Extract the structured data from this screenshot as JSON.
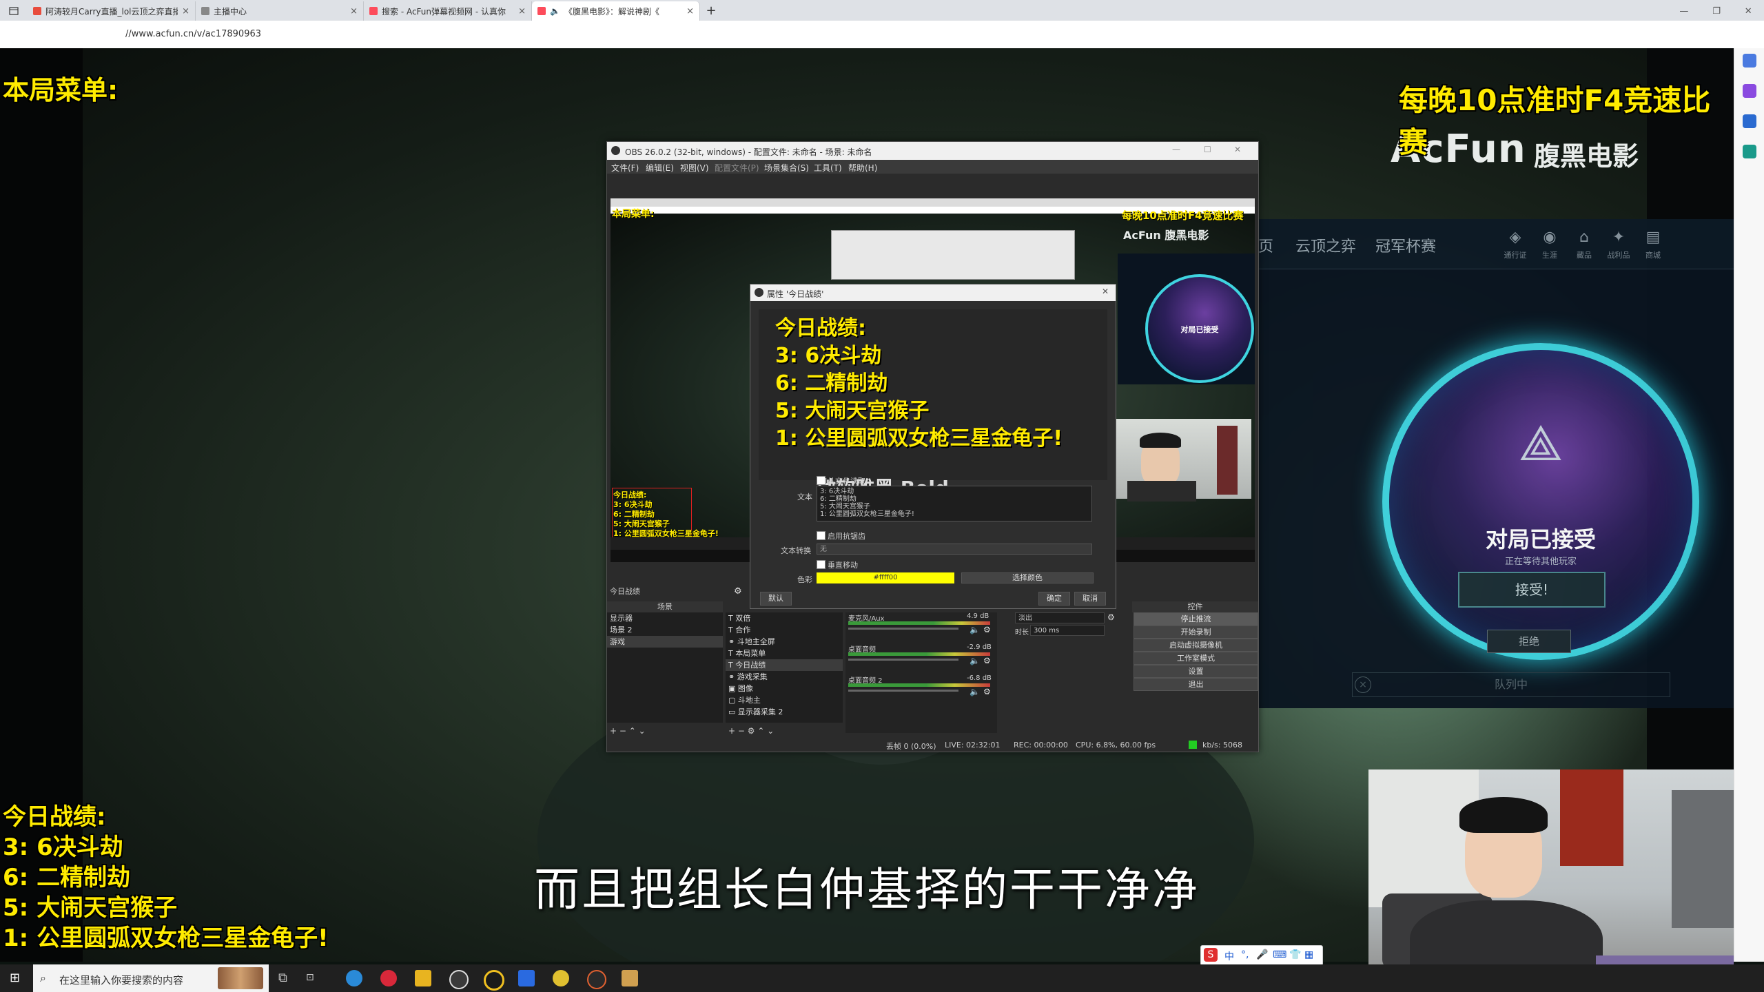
{
  "browser": {
    "tabs": [
      {
        "title": "阿涛较月Carry直播_lol云顶之弈直播",
        "favicon_color": "#e84c3d"
      },
      {
        "title": "主播中心",
        "favicon_color": "#888888"
      },
      {
        "title": "搜索 - AcFun弹幕视频网 - 认真你",
        "favicon_color": "#fd4c5b"
      },
      {
        "title": "《腹黑电影》：解说神剧《",
        "favicon_color": "#fd4c5b"
      }
    ],
    "new_tab": "+",
    "url": "//www.acfun.cn/v/ac17890963"
  },
  "overlay": {
    "menu_label": "本局菜单:",
    "top_right_banner": "每晚10点准时F4竞速比赛",
    "acfun_logo": "AcFun",
    "acfun_channel": "腹黑电影",
    "stats_lines": [
      "今日战绩:",
      "3: 6决斗劫",
      "6: 二精制劫",
      "5: 大闹天宫猴子",
      "1: 公里圆弧双女枪三星金龟子!"
    ],
    "subtitle": "而且把组长白仲基择的干干净净"
  },
  "lol": {
    "nav": [
      "页",
      "云顶之弈",
      "冠军杯赛"
    ],
    "nav_icons": [
      {
        "icon": "pass-icon",
        "label": "通行证"
      },
      {
        "icon": "profile-icon",
        "label": "生涯"
      },
      {
        "icon": "collection-icon",
        "label": "藏品"
      },
      {
        "icon": "loot-icon",
        "label": "战利品"
      },
      {
        "icon": "store-icon",
        "label": "商城"
      }
    ],
    "match_title": "对局已接受",
    "match_sub": "正在等待其他玩家",
    "accept_label": "接受!",
    "decline_label": "拒绝",
    "queue_label": "队列中"
  },
  "obs": {
    "title": "OBS 26.0.2 (32-bit, windows) - 配置文件: 未命名 - 场景: 未命名",
    "menu": [
      "文件(F)",
      "编辑(E)",
      "视图(V)",
      "配置文件(P)",
      "场景集合(S)",
      "工具(T)",
      "帮助(H)"
    ],
    "preview_menu_label": "本局菜单:",
    "preview_banner": "每晚10点准时F4竞速比赛",
    "preview_logo": "AcFun 腹黑电影",
    "preview_ring_title": "对局已接受",
    "preview_stats": [
      "今日战绩:",
      "3: 6决斗劫",
      "6: 二精制劫",
      "5: 大闹天宫猴子",
      "1: 公里圆弧双女枪三星金龟子!"
    ],
    "source_label": "今日战绩",
    "panels": {
      "scenes": "场景",
      "controls": "控件"
    },
    "scenes": [
      "显示器",
      "场景 2",
      "游戏"
    ],
    "sources": [
      "双倍",
      "合作",
      "斗地主全屏",
      "本局菜单",
      "今日战绩",
      "游戏采集",
      "图像",
      "斗地主",
      "显示器采集 2"
    ],
    "mixer": [
      {
        "name": "麦克风/Aux",
        "db": "4.9 dB"
      },
      {
        "name": "桌面音频",
        "db": "-2.9 dB"
      },
      {
        "name": "桌面音频 2",
        "db": "-6.8 dB"
      }
    ],
    "transition": {
      "type": "淡出",
      "duration_label": "时长",
      "duration": "300 ms"
    },
    "controls": [
      "停止推流",
      "开始录制",
      "启动虚拟摄像机",
      "工作室模式",
      "设置",
      "退出"
    ],
    "status": {
      "dropped": "丢帧 0 (0.0%)",
      "live": "LIVE: 02:32:01",
      "rec": "REC: 00:00:00",
      "cpu": "CPU: 6.8%, 60.00 fps",
      "kbps": "kb/s: 5068"
    }
  },
  "dialog": {
    "title": "属性 '今日战绩'",
    "preview_lines": [
      "今日战绩:",
      "3: 6决斗劫",
      "6: 二精制劫",
      "5: 大闹天宫猴子",
      "1: 公里圆弧双女枪三星金龟子!"
    ],
    "font_partial": "微软雅黑 Bold",
    "read_from_file": "从文件读取",
    "text_label": "文本",
    "text_value_lines": [
      "3: 6决斗劫",
      "6: 二精制劫",
      "5: 大闹天宫猴子",
      "1: 公里圆弧双女枪三星金龟子!"
    ],
    "antialias": "启用抗锯齿",
    "transform_label": "文本转换",
    "transform_value": "无",
    "vertical": "垂直移动",
    "color_label": "色彩",
    "color_value": "#ffff00",
    "pick_color": "选择颜色",
    "default_btn": "默认",
    "ok_btn": "确定",
    "cancel_btn": "取消"
  },
  "taskbar": {
    "search_placeholder": "在这里输入你要搜索的内容",
    "ime_text": "中"
  },
  "colors": {
    "overlay_yellow": "#ffeb00",
    "lol_cyan": "#3fd4e0",
    "obs_bg": "#2b2b2b"
  }
}
